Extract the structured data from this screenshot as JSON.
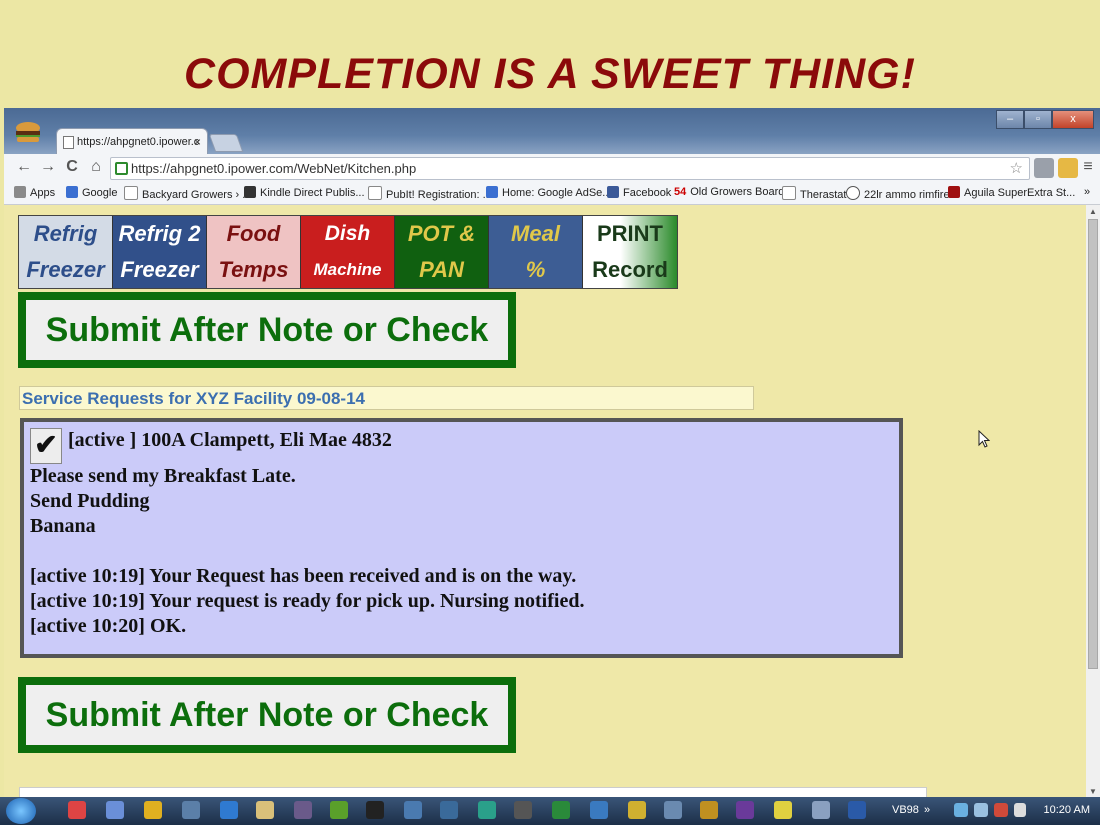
{
  "slide": {
    "title": "COMPLETION IS A SWEET THING!"
  },
  "browser": {
    "tab_title": "https://ahpgnet0.ipower.c",
    "tab_close": "×",
    "url_host": "https://ahpgnet0.ipower.com/WebNet/Kitchen.php",
    "window_controls": [
      "–",
      "▫",
      "x"
    ],
    "nav": {
      "back": "←",
      "forward": "→",
      "reload": "C",
      "home": "⌂",
      "star": "☆",
      "menu": "≡"
    },
    "bookmarks": [
      "Apps",
      "Google",
      "Backyard Growers › ...",
      "Kindle Direct Publis...",
      "PubIt! Registration: ...",
      "Home: Google AdSe...",
      "Facebook",
      "Old Growers Board",
      "Therastat",
      "22lr ammo rimfire",
      "Aguila SuperExtra St..."
    ],
    "bookmark_badge": "54",
    "bookmarks_more": "»"
  },
  "nav_buttons": [
    {
      "line1": "Refrig",
      "line2": "Freezer"
    },
    {
      "line1": "Refrig 2",
      "line2": "Freezer"
    },
    {
      "line1": "Food",
      "line2": "Temps"
    },
    {
      "line1": "Dish",
      "line2": "Machine"
    },
    {
      "line1": "POT &",
      "line2": "PAN"
    },
    {
      "line1": "Meal",
      "line2": "%"
    },
    {
      "line1": "PRINT",
      "line2": "Record"
    }
  ],
  "submit_label": "Submit After Note or Check",
  "requests": {
    "header": "Service Requests for XYZ Facility  09-08-14",
    "checked": true,
    "check_mark": "✔",
    "lines": [
      "[active ] 100A Clampett, Eli Mae 4832",
      "Please send my Breakfast Late.",
      "Send Pudding",
      "Banana",
      "",
      "[active 10:19] Your Request has been received and is on the way.",
      "[active 10:19] Your request is ready for pick up. Nursing notified.",
      "[active 10:20] OK."
    ]
  },
  "taskbar": {
    "tray_label": "VB98",
    "tray_more": "»",
    "clock": "10:20 AM"
  },
  "colors": {
    "title": "#8b0a0a",
    "submit_border": "#0c6e0c",
    "request_bg": "#cbcbf9",
    "request_header": "#3c6fb0"
  }
}
